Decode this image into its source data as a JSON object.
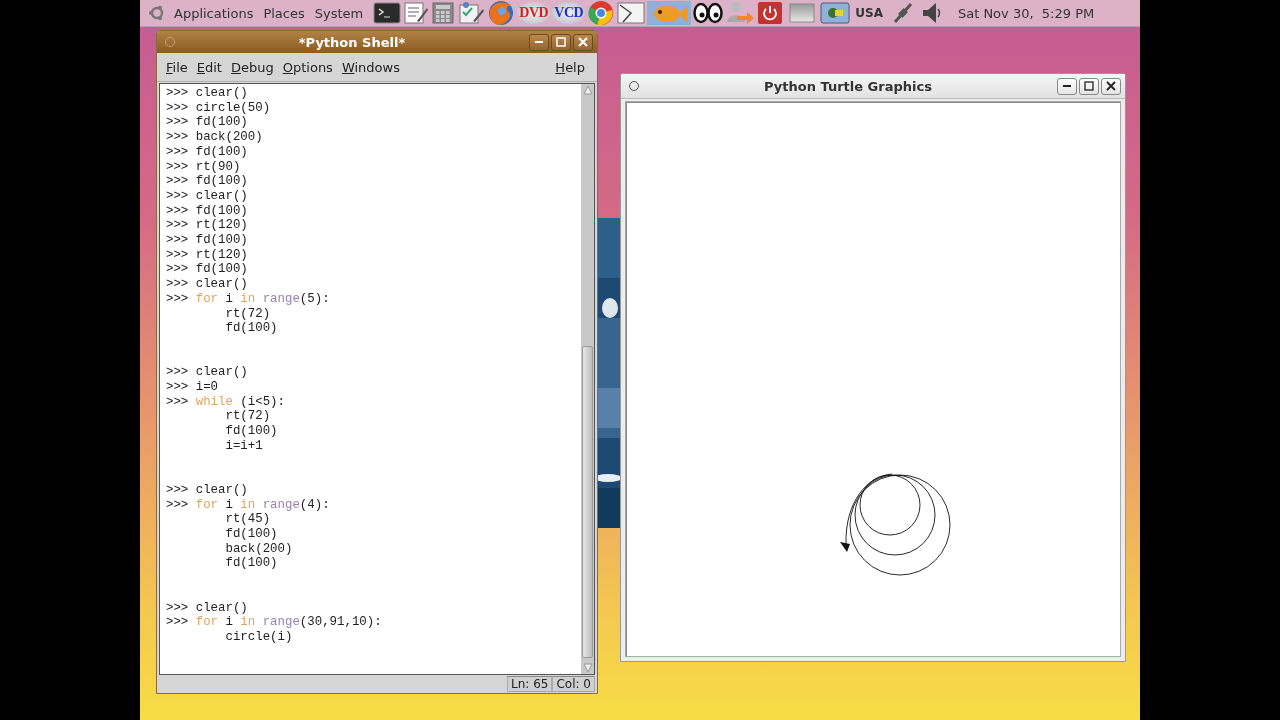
{
  "panel": {
    "menus": [
      "Applications",
      "Places",
      "System"
    ],
    "launchers": [
      {
        "kind": "terminal"
      },
      {
        "kind": "editor"
      },
      {
        "kind": "calculator"
      },
      {
        "kind": "tasks"
      },
      {
        "kind": "browser"
      },
      {
        "kind": "disc",
        "label": "DVD",
        "color": "#d42020"
      },
      {
        "kind": "disc",
        "label": "VCD",
        "color": "#2030c0"
      },
      {
        "kind": "chrome"
      },
      {
        "kind": "drawing"
      },
      {
        "kind": "fish"
      },
      {
        "kind": "eyes"
      },
      {
        "kind": "user-switch"
      },
      {
        "kind": "power"
      }
    ],
    "keyboard_layout": "USA",
    "clock": "Sat Nov 30,  5:29 PM"
  },
  "shell_window": {
    "title": "*Python Shell*",
    "menus": [
      "File",
      "Edit",
      "Debug",
      "Options",
      "Windows"
    ],
    "help_menu": "Help",
    "lines": [
      {
        "prompt": ">>>",
        "segments": [
          {
            "text": "clear()",
            "kind": "plain"
          }
        ]
      },
      {
        "prompt": ">>>",
        "segments": [
          {
            "text": "circle(50)",
            "kind": "plain"
          }
        ]
      },
      {
        "prompt": ">>>",
        "segments": [
          {
            "text": "fd(100)",
            "kind": "plain"
          }
        ]
      },
      {
        "prompt": ">>>",
        "segments": [
          {
            "text": "back(200)",
            "kind": "plain"
          }
        ]
      },
      {
        "prompt": ">>>",
        "segments": [
          {
            "text": "fd(100)",
            "kind": "plain"
          }
        ]
      },
      {
        "prompt": ">>>",
        "segments": [
          {
            "text": "rt(90)",
            "kind": "plain"
          }
        ]
      },
      {
        "prompt": ">>>",
        "segments": [
          {
            "text": "fd(100)",
            "kind": "plain"
          }
        ]
      },
      {
        "prompt": ">>>",
        "segments": [
          {
            "text": "clear()",
            "kind": "plain"
          }
        ]
      },
      {
        "prompt": ">>>",
        "segments": [
          {
            "text": "fd(100)",
            "kind": "plain"
          }
        ]
      },
      {
        "prompt": ">>>",
        "segments": [
          {
            "text": "rt(120)",
            "kind": "plain"
          }
        ]
      },
      {
        "prompt": ">>>",
        "segments": [
          {
            "text": "fd(100)",
            "kind": "plain"
          }
        ]
      },
      {
        "prompt": ">>>",
        "segments": [
          {
            "text": "rt(120)",
            "kind": "plain"
          }
        ]
      },
      {
        "prompt": ">>>",
        "segments": [
          {
            "text": "fd(100)",
            "kind": "plain"
          }
        ]
      },
      {
        "prompt": ">>>",
        "segments": [
          {
            "text": "clear()",
            "kind": "plain"
          }
        ]
      },
      {
        "prompt": ">>>",
        "segments": [
          {
            "text": "for",
            "kind": "keyword"
          },
          {
            "text": " i ",
            "kind": "plain"
          },
          {
            "text": "in ",
            "kind": "keyword"
          },
          {
            "text": "range",
            "kind": "builtin"
          },
          {
            "text": "(5):",
            "kind": "plain"
          }
        ]
      },
      {
        "segments": [
          {
            "text": "rt(72)",
            "kind": "plain"
          }
        ]
      },
      {
        "segments": [
          {
            "text": "fd(100)",
            "kind": "plain"
          }
        ]
      },
      {
        "prompt": ">>>",
        "gap_before": true,
        "segments": [
          {
            "text": "clear()",
            "kind": "plain"
          }
        ]
      },
      {
        "prompt": ">>>",
        "segments": [
          {
            "text": "i=0",
            "kind": "plain"
          }
        ]
      },
      {
        "prompt": ">>>",
        "segments": [
          {
            "text": "while",
            "kind": "keyword"
          },
          {
            "text": " (i<5):",
            "kind": "plain"
          }
        ]
      },
      {
        "segments": [
          {
            "text": "rt(72)",
            "kind": "plain"
          }
        ]
      },
      {
        "segments": [
          {
            "text": "fd(100)",
            "kind": "plain"
          }
        ]
      },
      {
        "segments": [
          {
            "text": "i=i+1",
            "kind": "plain"
          }
        ]
      },
      {
        "prompt": ">>>",
        "gap_before": true,
        "segments": [
          {
            "text": "clear()",
            "kind": "plain"
          }
        ]
      },
      {
        "prompt": ">>>",
        "segments": [
          {
            "text": "for",
            "kind": "keyword"
          },
          {
            "text": " i ",
            "kind": "plain"
          },
          {
            "text": "in ",
            "kind": "keyword"
          },
          {
            "text": "range",
            "kind": "builtin"
          },
          {
            "text": "(4):",
            "kind": "plain"
          }
        ]
      },
      {
        "segments": [
          {
            "text": "rt(45)",
            "kind": "plain"
          }
        ]
      },
      {
        "segments": [
          {
            "text": "fd(100)",
            "kind": "plain"
          }
        ]
      },
      {
        "segments": [
          {
            "text": "back(200)",
            "kind": "plain"
          }
        ]
      },
      {
        "segments": [
          {
            "text": "fd(100)",
            "kind": "plain"
          }
        ]
      },
      {
        "prompt": ">>>",
        "gap_before": true,
        "segments": [
          {
            "text": "clear()",
            "kind": "plain"
          }
        ]
      },
      {
        "prompt": ">>>",
        "segments": [
          {
            "text": "for",
            "kind": "keyword"
          },
          {
            "text": " i ",
            "kind": "plain"
          },
          {
            "text": "in ",
            "kind": "keyword"
          },
          {
            "text": "range",
            "kind": "builtin"
          },
          {
            "text": "(30,91,10):",
            "kind": "plain"
          }
        ]
      },
      {
        "segments": [
          {
            "text": "circle(i)",
            "kind": "plain"
          }
        ]
      }
    ],
    "status": {
      "line": "Ln: 65",
      "column": "Col: 0"
    }
  },
  "turtle_window": {
    "title": "Python Turtle Graphics"
  }
}
